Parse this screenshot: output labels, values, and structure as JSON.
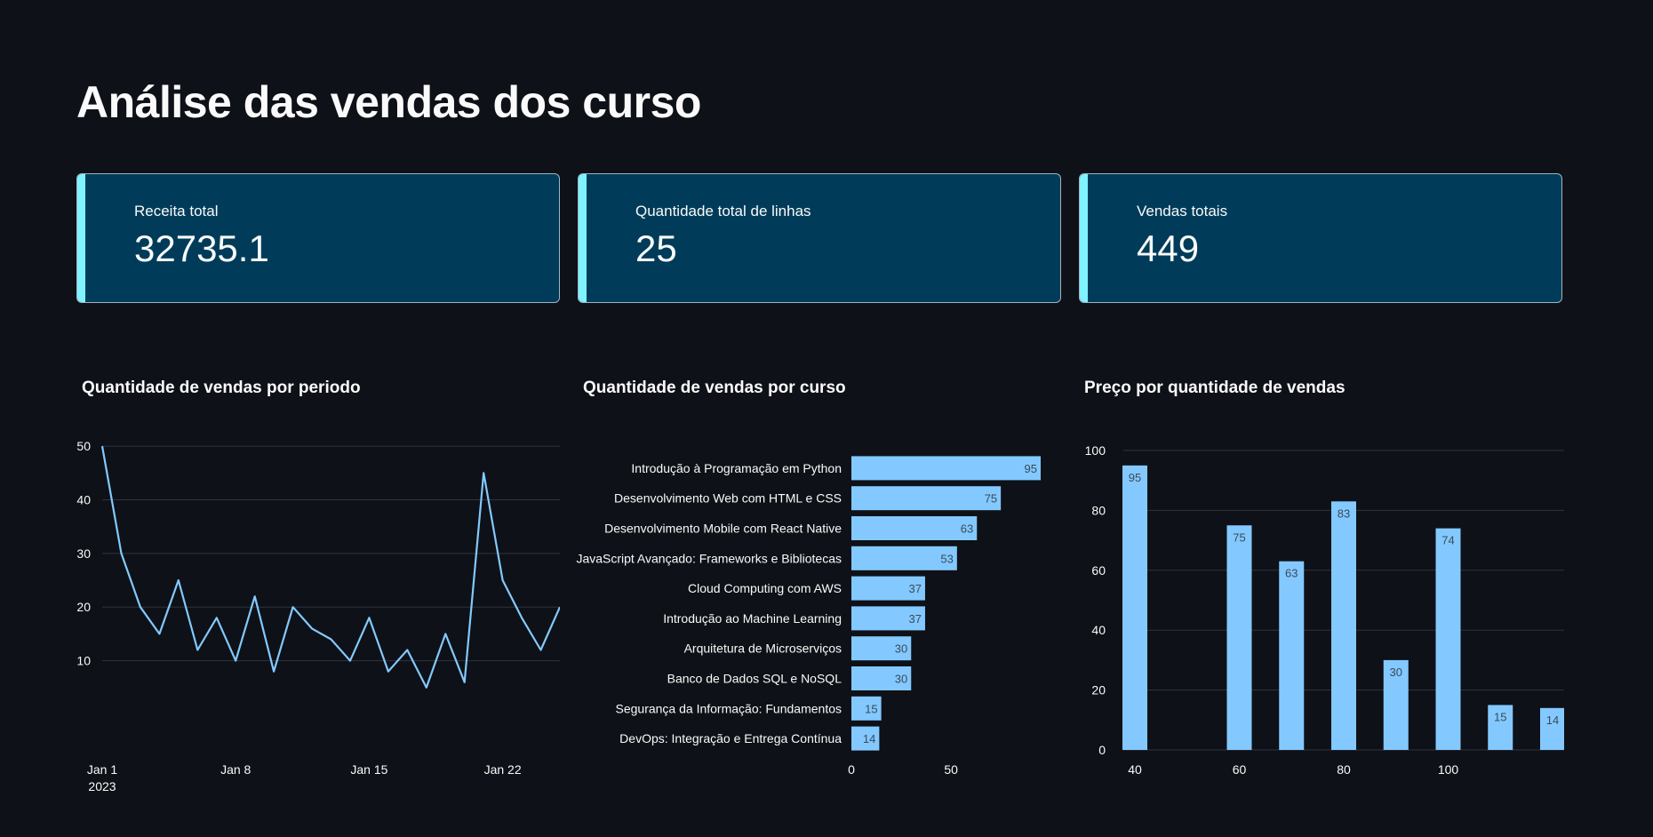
{
  "page": {
    "title": "Análise das vendas dos curso"
  },
  "metrics": [
    {
      "label": "Receita total",
      "value": "32735.1"
    },
    {
      "label": "Quantidade total de linhas",
      "value": "25"
    },
    {
      "label": "Vendas totais",
      "value": "449"
    }
  ],
  "colors": {
    "background": "#0e1117",
    "card": "#003c5a",
    "accent": "#7ff3ff",
    "series": "#83c9ff"
  },
  "chart_data": [
    {
      "type": "line",
      "title": "Quantidade de vendas por periodo",
      "x": [
        "2023-01-01",
        "2023-01-02",
        "2023-01-03",
        "2023-01-04",
        "2023-01-05",
        "2023-01-06",
        "2023-01-07",
        "2023-01-08",
        "2023-01-09",
        "2023-01-10",
        "2023-01-11",
        "2023-01-12",
        "2023-01-13",
        "2023-01-14",
        "2023-01-15",
        "2023-01-16",
        "2023-01-17",
        "2023-01-18",
        "2023-01-19",
        "2023-01-20",
        "2023-01-21",
        "2023-01-22",
        "2023-01-23",
        "2023-01-24",
        "2023-01-25"
      ],
      "values": [
        50,
        30,
        20,
        15,
        25,
        12,
        18,
        10,
        22,
        8,
        20,
        16,
        14,
        10,
        18,
        8,
        12,
        5,
        15,
        6,
        45,
        25,
        18,
        12,
        20
      ],
      "y_ticks": [
        10,
        20,
        30,
        40,
        50
      ],
      "x_ticks": [
        "Jan 1",
        "Jan 8",
        "Jan 15",
        "Jan 22"
      ],
      "x_tick_year": "2023",
      "grid": true
    },
    {
      "type": "bar",
      "orientation": "horizontal",
      "title": "Quantidade de vendas por curso",
      "categories": [
        "Introdução à Programação em Python",
        "Desenvolvimento Web com HTML e CSS",
        "Desenvolvimento Mobile com React Native",
        "JavaScript Avançado: Frameworks e Bibliotecas",
        "Cloud Computing com AWS",
        "Introdução ao Machine Learning",
        "Arquitetura de Microserviços",
        "Banco de Dados SQL e NoSQL",
        "Segurança da Informação: Fundamentos",
        "DevOps: Integração e Entrega Contínua"
      ],
      "values": [
        95,
        75,
        63,
        53,
        37,
        37,
        30,
        30,
        15,
        14
      ],
      "x_ticks": [
        0,
        50
      ],
      "xlim": [
        0,
        95
      ]
    },
    {
      "type": "bar",
      "title": "Preço por quantidade de vendas",
      "x": [
        40,
        60,
        70,
        80,
        90,
        100,
        110,
        120
      ],
      "values": [
        95,
        75,
        63,
        83,
        30,
        74,
        15,
        14
      ],
      "x_ticks": [
        40,
        60,
        80,
        100
      ],
      "y_ticks": [
        0,
        20,
        40,
        60,
        80,
        100
      ],
      "ylim": [
        0,
        100
      ],
      "grid": true
    }
  ]
}
